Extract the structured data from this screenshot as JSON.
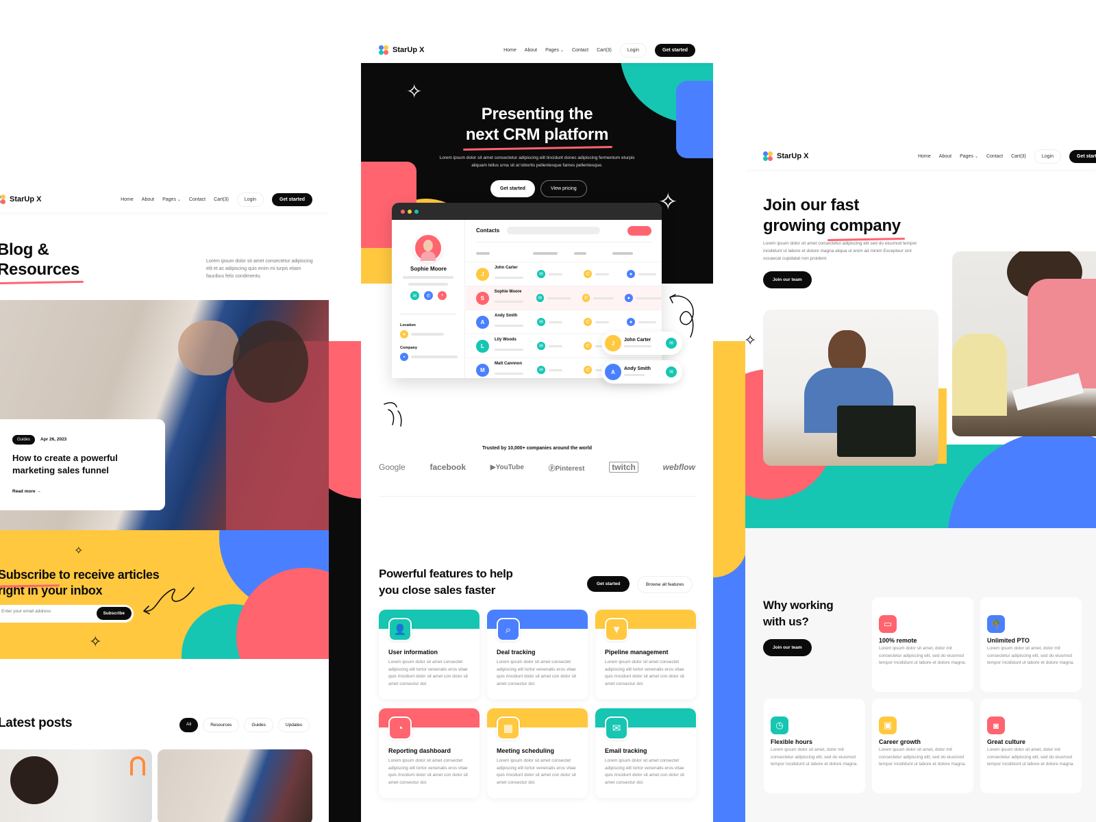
{
  "brand": {
    "name": "StarUp X"
  },
  "colors": {
    "black": "#0b0b0b",
    "red": "#ff646f",
    "yellow": "#ffc83f",
    "teal": "#16c6b2",
    "blue": "#4a80ff"
  },
  "nav": {
    "links": [
      "Home",
      "About",
      "Pages",
      "Contact",
      "Cart(3)"
    ],
    "login": "Login",
    "cta": "Get started"
  },
  "blog_page": {
    "title_line1": "Blog &",
    "title_line2": "Resources",
    "intro": "Lorem ipsum dolor sit amet consectetur adipiscing elit et ac adipiscing quis enim mi turpis etiam faucibus felis condimentu.",
    "featured": {
      "tag": "Guides",
      "date": "Apr 26, 2023",
      "title": "How to create a powerful marketing sales funnel",
      "read_more": "Read more"
    },
    "subscribe": {
      "title_highlight": "Subscribe",
      "title_rest_line1": " to receive articles",
      "title_line2": "right in your inbox",
      "placeholder": "Enter your email address",
      "button": "Subscribe"
    },
    "latest": {
      "title": "Latest posts",
      "filters": [
        "All",
        "Resources",
        "Guides",
        "Updates"
      ],
      "active_filter": "All"
    }
  },
  "crm_page": {
    "hero": {
      "title_line1": "Presenting the",
      "title_line2": "next CRM platform",
      "subtitle": "Lorem ipsum dolor sit amet consectetur adipiscing elit tincidunt donec adipiscing fermentum eturpis aliquam tellus urna sit at lobortis pellentesque fames pellentesque.",
      "primary_button": "Get started",
      "secondary_button": "View pricing"
    },
    "app_mock": {
      "profile_name": "Sophie Moore",
      "location_label": "Location",
      "company_label": "Company",
      "contacts_title": "Contacts",
      "contacts": [
        {
          "name": "John Carter",
          "color": "#ffc83f",
          "highlighted": false
        },
        {
          "name": "Sophie Moore",
          "color": "#ff646f",
          "highlighted": true
        },
        {
          "name": "Andy Smith",
          "color": "#4a80ff",
          "highlighted": false
        },
        {
          "name": "Lily Woods",
          "color": "#16c6b2",
          "highlighted": false
        },
        {
          "name": "Matt Cannnon",
          "color": "#4a80ff",
          "highlighted": false
        }
      ],
      "floating_cards": [
        {
          "name": "John Carter",
          "color": "#ffc83f"
        },
        {
          "name": "Andy Smith",
          "color": "#4a80ff"
        }
      ]
    },
    "trusted": {
      "text": "Trusted by 10,000+ companies around the world",
      "logos": [
        "Google",
        "facebook",
        "YouTube",
        "Pinterest",
        "twitch",
        "webflow"
      ]
    },
    "features": {
      "title_line1": "Powerful features to help",
      "title_line2": "you close sales faster",
      "primary_button": "Get started",
      "secondary_button": "Browse all features",
      "items": [
        {
          "title": "User information",
          "icon": "user-icon",
          "color": "#16c6b2",
          "desc": "Lorem ipsum dolor sit amet consectet adipiscing elit tortor venenatis eros vitae quis rincidunt dolor sit amet con dolor sit amet consectur dol."
        },
        {
          "title": "Deal tracking",
          "icon": "search-icon",
          "color": "#4a80ff",
          "desc": "Lorem ipsum dolor sit amet consectet adipiscing elit tortor venenatis eros vitae quis rincidunt dolor sit amet con dolor sit amet consectur dol."
        },
        {
          "title": "Pipeline management",
          "icon": "funnel-icon",
          "color": "#ffc83f",
          "desc": "Lorem ipsum dolor sit amet consectet adipiscing elit tortor venenatis eros vitae quis rincidunt dolor sit amet con dolor sit amet consectur dol."
        },
        {
          "title": "Reporting dashboard",
          "icon": "pie-chart-icon",
          "color": "#ff646f",
          "desc": "Lorem ipsum dolor sit amet consectet adipiscing elit tortor venenatis eros vitae quis rincidunt dolor sit amet con dolor sit amet consectur dol."
        },
        {
          "title": "Meeting scheduling",
          "icon": "calendar-icon",
          "color": "#ffc83f",
          "desc": "Lorem ipsum dolor sit amet consectet adipiscing elit tortor venenatis eros vitae quis rincidunt dolor sit amet con dolor sit amet consectur dol."
        },
        {
          "title": "Email tracking",
          "icon": "mail-icon",
          "color": "#16c6b2",
          "desc": "Lorem ipsum dolor sit amet consectet adipiscing elit tortor venenatis eros vitae quis rincidunt dolor sit amet con dolor sit amet consectur dol."
        }
      ]
    }
  },
  "careers_page": {
    "hero": {
      "title_line1": "Join our fast",
      "title_line2_a": "growing ",
      "title_line2_b": "company",
      "subtitle": "Lorem ipsum dolor sit amet consectetur adipiscing elit sed do eiusmod tempor incididunt ut labore et dolore magna aliqua ut enim ad minim Excepteur sint occaecat cupidatat non proident.",
      "button": "Join our team"
    },
    "why": {
      "title_line1": "Why working",
      "title_line2": "with us?",
      "button": "Join our team",
      "items": [
        {
          "title": "100% remote",
          "icon": "laptop-icon",
          "color": "#ff646f",
          "desc": "Lorem ipsum dolor sit amet, dolor mit consectetur adipiscing elit, sed do eiusmod tempor incididunt ut labore et dolore magna."
        },
        {
          "title": "Unlimited PTO",
          "icon": "palm-tree-icon",
          "color": "#4a80ff",
          "desc": "Lorem ipsum dolor sit amet, dolor mit consectetur adipiscing elit, sed do eiusmod tempor incididunt ut labore et dolore magna."
        },
        {
          "title": "Flexible hours",
          "icon": "clock-icon",
          "color": "#16c6b2",
          "desc": "Lorem ipsum dolor sit amet, dolor mit consectetur adipiscing elit, sed do eiusmod tempor incididunt ut labore et dolore magna."
        },
        {
          "title": "Career growth",
          "icon": "briefcase-icon",
          "color": "#ffc83f",
          "desc": "Lorem ipsum dolor sit amet, dolor mit consectetur adipiscing elit, sed do eiusmod tempor incididunt ut labore et dolore magna."
        },
        {
          "title": "Great culture",
          "icon": "gamepad-icon",
          "color": "#ff646f",
          "desc": "Lorem ipsum dolor sit amet, dolor mit consectetur adipiscing elit, sed do eiusmod tempor incididunt ut labore et dolore magna."
        }
      ]
    }
  }
}
